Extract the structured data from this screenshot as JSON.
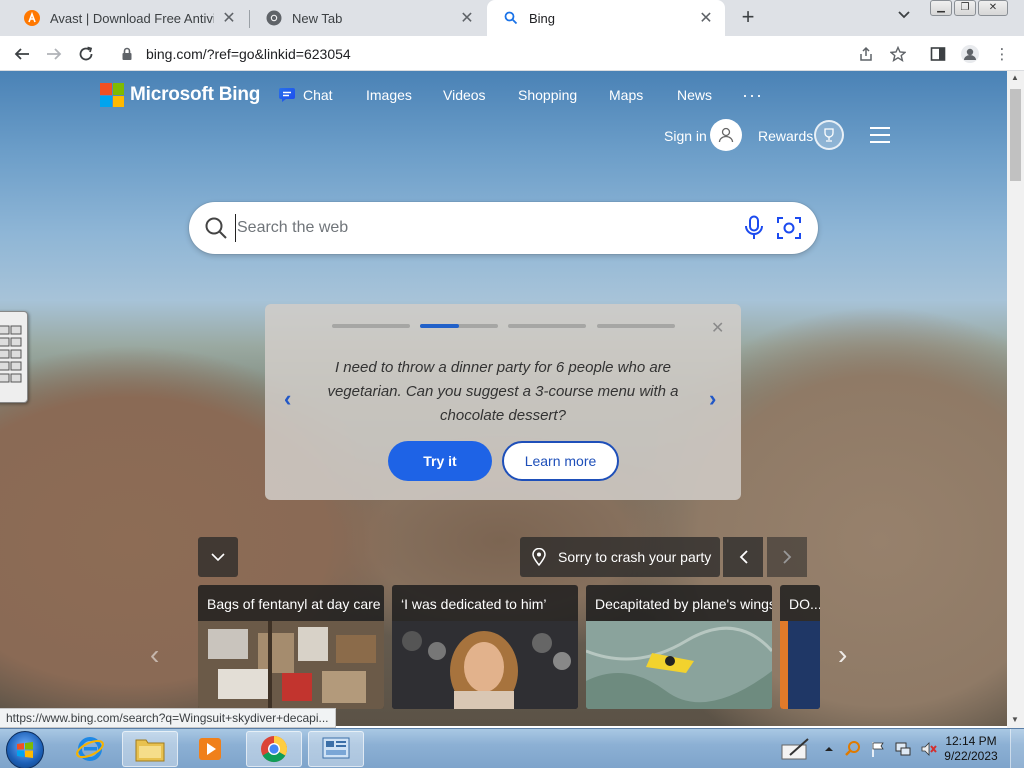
{
  "browser": {
    "tabs": [
      {
        "title": "Avast | Download Free Antivirus &",
        "icon": "avast-icon"
      },
      {
        "title": "New Tab",
        "icon": "chrome-icon"
      },
      {
        "title": "Bing",
        "icon": "search-icon",
        "active": true
      }
    ],
    "new_tab_label": "+",
    "url": "bing.com/?ref=go&linkid=623054"
  },
  "bing": {
    "logo_text": "Microsoft Bing",
    "nav": [
      "Chat",
      "Images",
      "Videos",
      "Shopping",
      "Maps",
      "News"
    ],
    "more": "···",
    "sign_in": "Sign in",
    "rewards": "Rewards",
    "search_placeholder": "Search the web",
    "prompt": {
      "text": "I need to throw a dinner party for 6 people who are vegetarian. Can you suggest a 3-course menu with a chocolate dessert?",
      "try_it": "Try it",
      "learn_more": "Learn more",
      "progress_count": 4,
      "active_index": 1,
      "active_fraction": 0.5
    },
    "image_info": "Sorry to crash your party",
    "news": [
      {
        "title": "Bags of fentanyl at day care"
      },
      {
        "title": "‘I was dedicated to him’"
      },
      {
        "title": "Decapitated by plane's wings"
      },
      {
        "title": "DO..."
      }
    ]
  },
  "status_url": "https://www.bing.com/search?q=Wingsuit+skydiver+decapi...",
  "taskbar": {
    "time": "12:14 PM",
    "date": "9/22/2023"
  },
  "colors": {
    "bing_blue": "#1e63e6",
    "tab_strip": "#dee1e6",
    "taskbar": "#8cb0d4"
  }
}
